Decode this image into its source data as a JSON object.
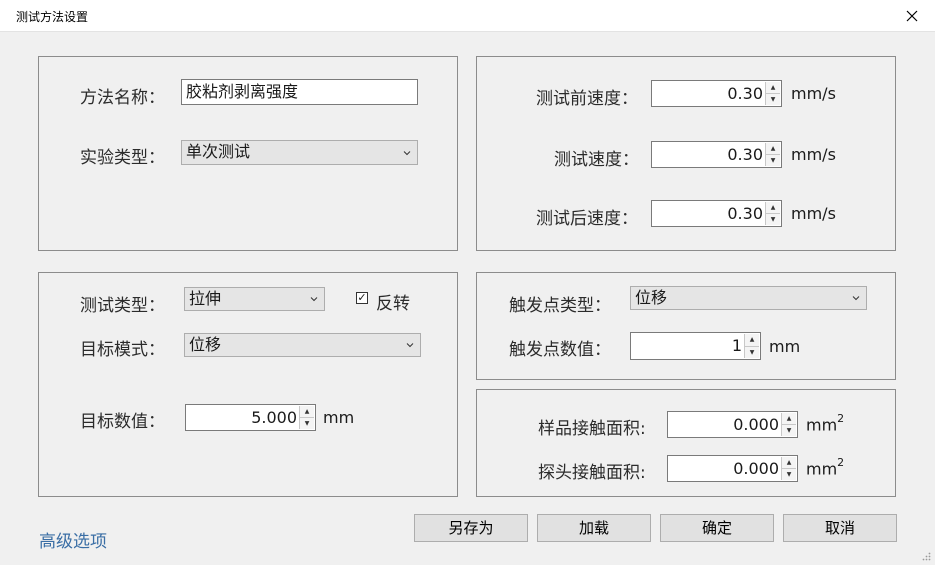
{
  "window": {
    "title": "测试方法设置",
    "close_icon": "close-icon"
  },
  "method": {
    "name_label": "方法名称：",
    "name_value": "胶粘剂剥离强度",
    "type_label": "实验类型：",
    "type_value": "单次测试"
  },
  "speed": {
    "pre_label": "测试前速度：",
    "pre_value": "0.30",
    "test_label": "测试速度：",
    "test_value": "0.30",
    "post_label": "测试后速度：",
    "post_value": "0.30",
    "unit": "mm/s"
  },
  "test": {
    "type_label": "测试类型：",
    "type_value": "拉伸",
    "reverse_label": "反转",
    "reverse_checked": true,
    "reverse_mark": "✓",
    "mode_label": "目标模式：",
    "mode_value": "位移",
    "value_label": "目标数值：",
    "value_value": "5.000",
    "value_unit": "mm"
  },
  "trigger": {
    "type_label": "触发点类型：",
    "type_value": "位移",
    "value_label": "触发点数值：",
    "value_value": "1",
    "value_unit": "mm"
  },
  "area": {
    "sample_label": "样品接触面积:",
    "sample_value": "0.000",
    "probe_label": "探头接触面积:",
    "probe_value": "0.000",
    "unit_base": "mm",
    "unit_sup": "2"
  },
  "footer": {
    "advanced_link": "高级选项",
    "save_as": "另存为",
    "load": "加载",
    "ok": "确定",
    "cancel": "取消"
  }
}
